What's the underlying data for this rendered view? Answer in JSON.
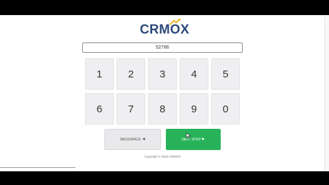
{
  "brand": {
    "logo_text": "CRMOX",
    "accent": "#f0b429",
    "primary": "#2d4a7c"
  },
  "pin_field": {
    "value": "52786"
  },
  "keypad": {
    "keys": [
      "1",
      "2",
      "3",
      "4",
      "5",
      "6",
      "7",
      "8",
      "9",
      "0"
    ]
  },
  "actions": {
    "backspace_label": "BACKSPACE",
    "next_label": "NEXT STEP",
    "next_color": "#28b35a"
  },
  "footer": {
    "copyright": "Copyright © 2020 CRMOX"
  }
}
